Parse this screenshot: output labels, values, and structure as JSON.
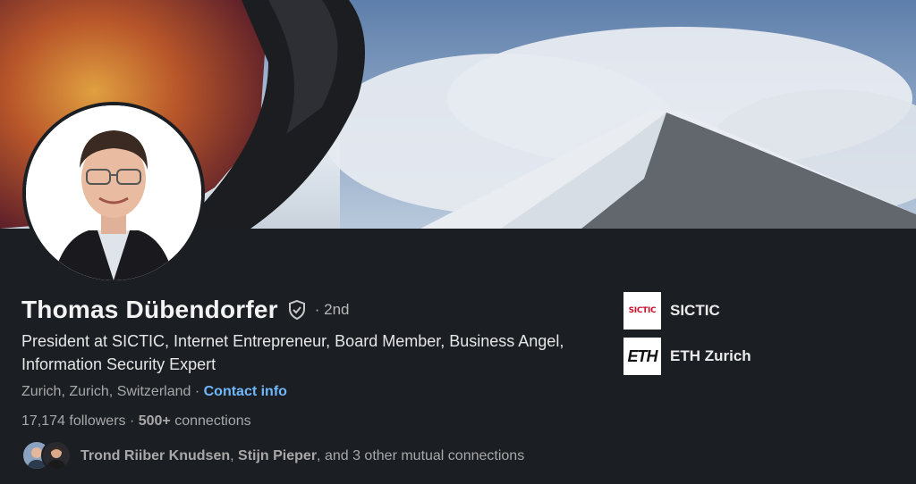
{
  "profile": {
    "name": "Thomas Dübendorfer",
    "degree": "· 2nd",
    "headline": "President at SICTIC, Internet Entrepreneur, Board Member, Business Angel, Information Security Expert",
    "location": "Zurich, Zurich, Switzerland",
    "location_sep": " · ",
    "contact_label": "Contact info",
    "followers": "17,174 followers",
    "stats_sep": " · ",
    "connections_count": "500+",
    "connections_label": " connections",
    "mutual": {
      "name_1": "Trond Riiber Knudsen",
      "sep": ", ",
      "name_2": "Stijn Pieper",
      "rest": ", and 3 other mutual connections"
    }
  },
  "companies": [
    {
      "name": "SICTIC",
      "logo_text": "SICTIC"
    },
    {
      "name": "ETH Zurich",
      "logo_text": "ETH"
    }
  ],
  "colors": {
    "background": "#1b1f23",
    "link": "#71b7fb",
    "text_primary": "#f3f3f3",
    "text_secondary": "#a8a8a8",
    "sictic_red": "#c8102e"
  }
}
